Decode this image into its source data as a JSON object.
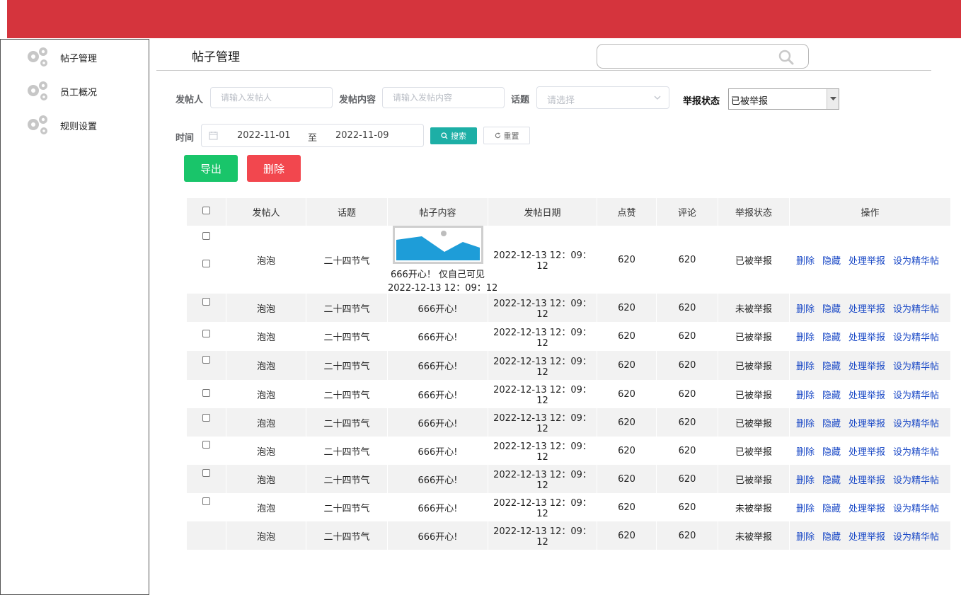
{
  "sidebar": {
    "items": [
      {
        "label": "帖子管理",
        "icon": "gear-icon"
      },
      {
        "label": "员工概况",
        "icon": "gear-icon"
      },
      {
        "label": "规则设置",
        "icon": "gear-icon"
      }
    ]
  },
  "header": {
    "title": "帖子管理",
    "search_placeholder": ""
  },
  "filters": {
    "poster_label": "发帖人",
    "poster_placeholder": "请输入发帖人",
    "content_label": "发帖内容",
    "content_placeholder": "请输入发帖内容",
    "topic_label": "话题",
    "topic_placeholder": "请选择",
    "report_label": "举报状态",
    "report_value": "已被举报",
    "time_label": "时间",
    "date_start": "2022-11-01",
    "date_sep": "至",
    "date_end": "2022-11-09",
    "search_button": "搜索",
    "reset_button": "重置"
  },
  "actions": {
    "export": "导出",
    "delete": "删除"
  },
  "colors": {
    "topbar": "#d5343d",
    "export": "#19c56a",
    "delete": "#f2474e",
    "search": "#1dafa6",
    "link": "#1948c6",
    "reported": "#e3141c"
  },
  "table": {
    "headers": [
      "发帖人",
      "话题",
      "帖子内容",
      "发帖日期",
      "点赞",
      "评论",
      "举报状态",
      "操作"
    ],
    "ops": [
      "删除",
      "隐藏",
      "处理举报",
      "设为精华帖"
    ],
    "first_row": {
      "poster": "泡泡",
      "topic": "二十四节气",
      "caption": "666开心！  仅自己可见",
      "caption_time": "2022-12-13 12：09：12",
      "date": "2022-12-13 12：09：12",
      "likes": "620",
      "comments": "620",
      "status": "已被举报"
    },
    "rows": [
      {
        "poster": "泡泡",
        "topic": "二十四节气",
        "content": "666开心!",
        "date": "2022-12-13 12：09：12",
        "likes": "620",
        "comments": "620",
        "status": "未被举报",
        "reported": false
      },
      {
        "poster": "泡泡",
        "topic": "二十四节气",
        "content": "666开心!",
        "date": "2022-12-13 12：09：12",
        "likes": "620",
        "comments": "620",
        "status": "已被举报",
        "reported": true
      },
      {
        "poster": "泡泡",
        "topic": "二十四节气",
        "content": "666开心!",
        "date": "2022-12-13 12：09：12",
        "likes": "620",
        "comments": "620",
        "status": "已被举报",
        "reported": true
      },
      {
        "poster": "泡泡",
        "topic": "二十四节气",
        "content": "666开心!",
        "date": "2022-12-13 12：09：12",
        "likes": "620",
        "comments": "620",
        "status": "已被举报",
        "reported": true
      },
      {
        "poster": "泡泡",
        "topic": "二十四节气",
        "content": "666开心!",
        "date": "2022-12-13 12：09：12",
        "likes": "620",
        "comments": "620",
        "status": "已被举报",
        "reported": true
      },
      {
        "poster": "泡泡",
        "topic": "二十四节气",
        "content": "666开心!",
        "date": "2022-12-13 12：09：12",
        "likes": "620",
        "comments": "620",
        "status": "已被举报",
        "reported": true
      },
      {
        "poster": "泡泡",
        "topic": "二十四节气",
        "content": "666开心!",
        "date": "2022-12-13 12：09：12",
        "likes": "620",
        "comments": "620",
        "status": "已被举报",
        "reported": true
      },
      {
        "poster": "泡泡",
        "topic": "二十四节气",
        "content": "666开心!",
        "date": "2022-12-13 12：09：12",
        "likes": "620",
        "comments": "620",
        "status": "未被举报",
        "reported": false
      },
      {
        "poster": "泡泡",
        "topic": "二十四节气",
        "content": "666开心!",
        "date": "2022-12-13 12：09：12",
        "likes": "620",
        "comments": "620",
        "status": "未被举报",
        "reported": false
      }
    ]
  }
}
